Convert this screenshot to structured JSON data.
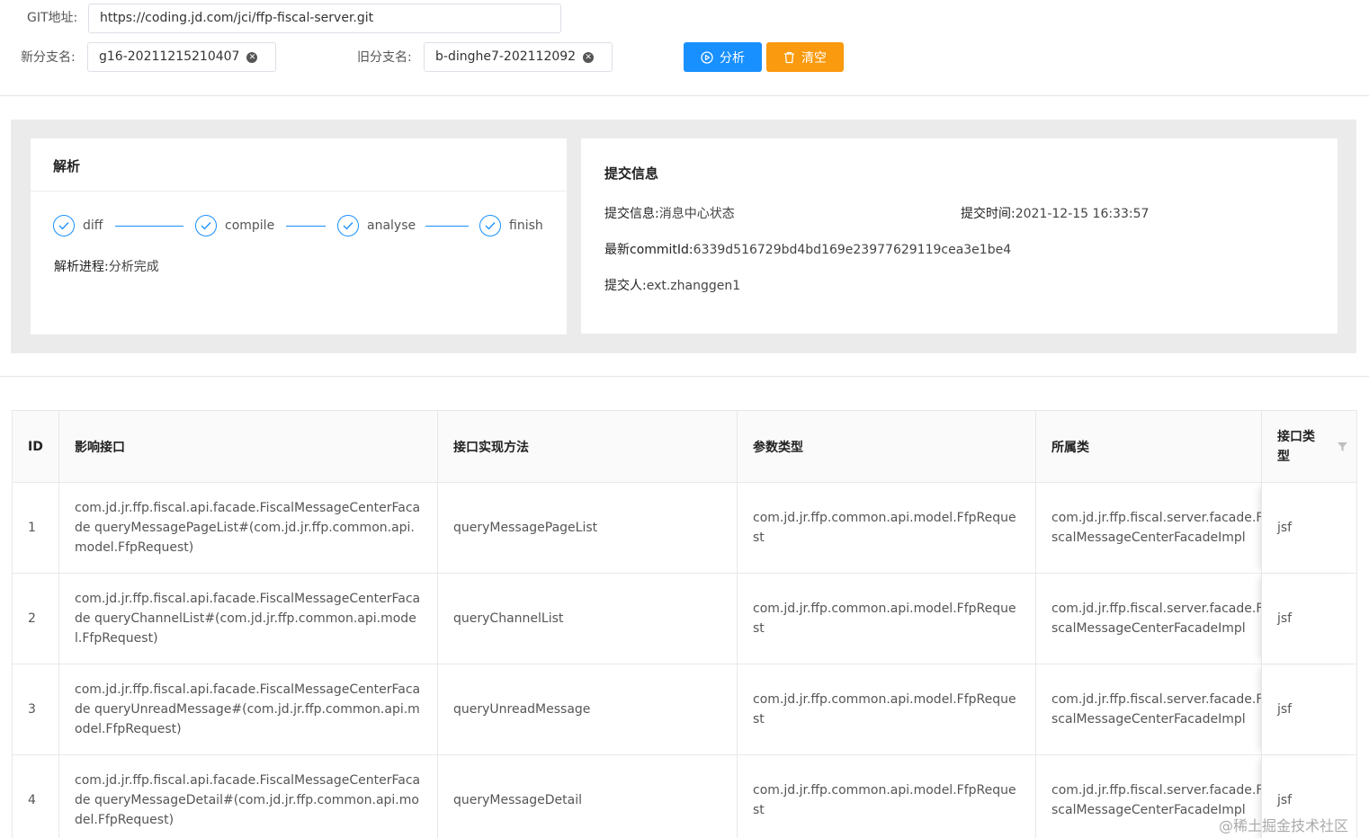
{
  "form": {
    "git_label": "GIT地址:",
    "git_value": "https://coding.jd.com/jci/ffp-fiscal-server.git",
    "new_branch_label": "新分支名:",
    "new_branch_value": "g16-20211215210407",
    "old_branch_label": "旧分支名:",
    "old_branch_value": "b-dinghe7-202112092",
    "analyze_label": "分析",
    "clear_label": "清空"
  },
  "parse_card": {
    "title": "解析",
    "steps": [
      {
        "label": "diff"
      },
      {
        "label": "compile"
      },
      {
        "label": "analyse"
      },
      {
        "label": "finish"
      }
    ],
    "progress_label": "解析进程:",
    "progress_value": "分析完成"
  },
  "commit_card": {
    "title": "提交信息",
    "message_label": "提交信息:",
    "message_value": "消息中心状态",
    "time_label": "提交时间:",
    "time_value": "2021-12-15 16:33:57",
    "commit_label": "最新commitId:",
    "commit_value": "6339d516729bd4bd169e23977629119cea3e1be4",
    "author_label": "提交人:",
    "author_value": "ext.zhanggen1"
  },
  "table": {
    "headers": [
      "ID",
      "影响接口",
      "接口实现方法",
      "参数类型",
      "所属类",
      "接口类型"
    ],
    "rows": [
      {
        "id": "1",
        "interface": "com.jd.jr.ffp.fiscal.api.facade.FiscalMessageCenterFacade queryMessagePageList#(com.jd.jr.ffp.common.api.model.FfpRequest)",
        "method": "queryMessagePageList",
        "param": "com.jd.jr.ffp.common.api.model.FfpRequest",
        "cls": "com.jd.jr.ffp.fiscal.server.facade.FiscalMessageCenterFacadeImpl",
        "type": "jsf"
      },
      {
        "id": "2",
        "interface": "com.jd.jr.ffp.fiscal.api.facade.FiscalMessageCenterFacade queryChannelList#(com.jd.jr.ffp.common.api.model.FfpRequest)",
        "method": "queryChannelList",
        "param": "com.jd.jr.ffp.common.api.model.FfpRequest",
        "cls": "com.jd.jr.ffp.fiscal.server.facade.FiscalMessageCenterFacadeImpl",
        "type": "jsf"
      },
      {
        "id": "3",
        "interface": "com.jd.jr.ffp.fiscal.api.facade.FiscalMessageCenterFacade queryUnreadMessage#(com.jd.jr.ffp.common.api.model.FfpRequest)",
        "method": "queryUnreadMessage",
        "param": "com.jd.jr.ffp.common.api.model.FfpRequest",
        "cls": "com.jd.jr.ffp.fiscal.server.facade.FiscalMessageCenterFacadeImpl",
        "type": "jsf"
      },
      {
        "id": "4",
        "interface": "com.jd.jr.ffp.fiscal.api.facade.FiscalMessageCenterFacade queryMessageDetail#(com.jd.jr.ffp.common.api.model.FfpRequest)",
        "method": "queryMessageDetail",
        "param": "com.jd.jr.ffp.common.api.model.FfpRequest",
        "cls": "com.jd.jr.ffp.fiscal.server.facade.FiscalMessageCenterFacadeImpl",
        "type": "jsf"
      }
    ]
  },
  "watermark": "@稀土掘金技术社区",
  "colors": {
    "primary": "#1890ff",
    "warning": "#fa9a0e",
    "panel_bg": "#ebebeb"
  }
}
